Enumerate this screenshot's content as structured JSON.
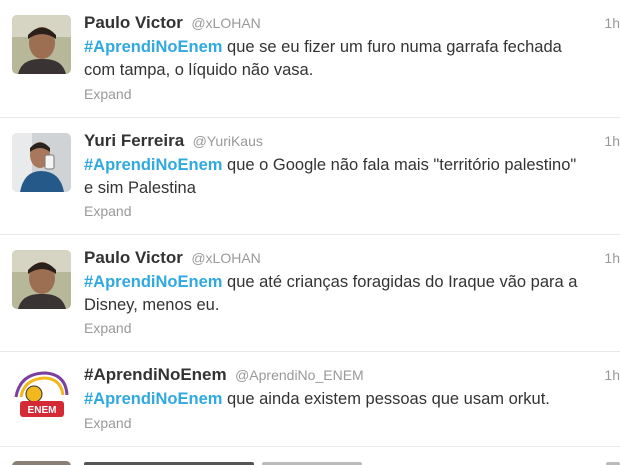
{
  "tweets": [
    {
      "name": "Paulo Victor",
      "handle": "@xLOHAN",
      "time": "1h",
      "hashtag": "#AprendiNoEnem",
      "text_line1": " que se eu fizer um furo numa garrafa fechada",
      "text_line2": "com tampa, o líquido não vasa.",
      "expand": "Expand"
    },
    {
      "name": "Yuri Ferreira",
      "handle": "@YuriKaus",
      "time": "1h",
      "hashtag": "#AprendiNoEnem",
      "text_line1": " que o Google não fala mais \"território palestino\"",
      "text_line2": "e sim Palestina",
      "expand": "Expand"
    },
    {
      "name": "Paulo Victor",
      "handle": "@xLOHAN",
      "time": "1h",
      "hashtag": "#AprendiNoEnem",
      "text_line1": " que até crianças foragidas do Iraque vão para a",
      "text_line2": "Disney, menos eu.",
      "expand": "Expand"
    },
    {
      "name": "#AprendiNoEnem",
      "handle": "@AprendiNo_ENEM",
      "time": "1h",
      "hashtag": "#AprendiNoEnem",
      "text_line1": " que ainda existem pessoas que usam orkut.",
      "text_line2": "",
      "expand": "Expand"
    }
  ],
  "avatar_logo_text": "ENEM",
  "colors": {
    "hashtag": "#2fa9e0",
    "meta": "#999999",
    "border": "#e8e8e8"
  }
}
